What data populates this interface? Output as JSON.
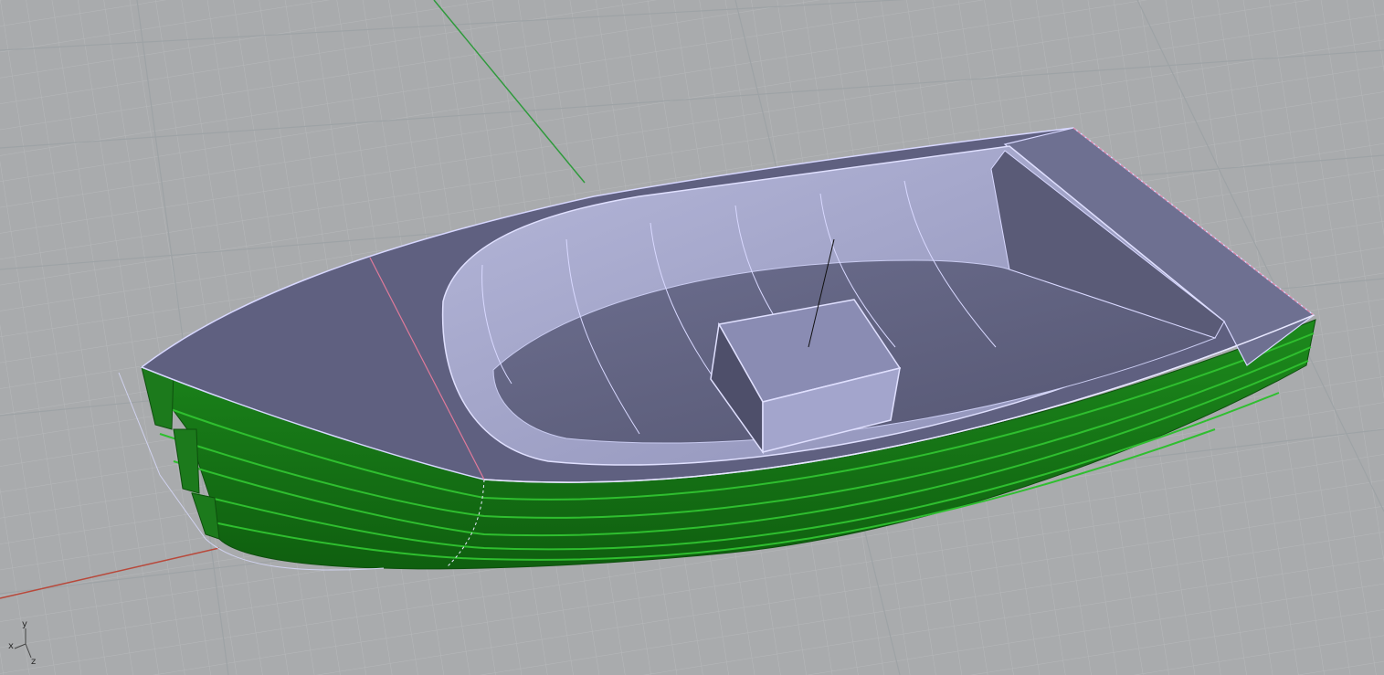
{
  "viewport": {
    "background_color": "#a9abad",
    "grid_minor_color": "#b6b8ba",
    "grid_major_color": "#9ea3a6",
    "x_axis_color": "#b8483a",
    "y_axis_color": "#2f9a3c"
  },
  "model": {
    "hull_color": "#1d8a1d",
    "hull_dark_color": "#0f5f0f",
    "deck_color": "#5f6080",
    "interior_color": "#9a9cc4",
    "edge_highlight_color": "#d8d8ff",
    "seam_color": "#e07a9a"
  },
  "axis_widget": {
    "y_label": "y",
    "x_label": "x",
    "z_label": "z"
  }
}
